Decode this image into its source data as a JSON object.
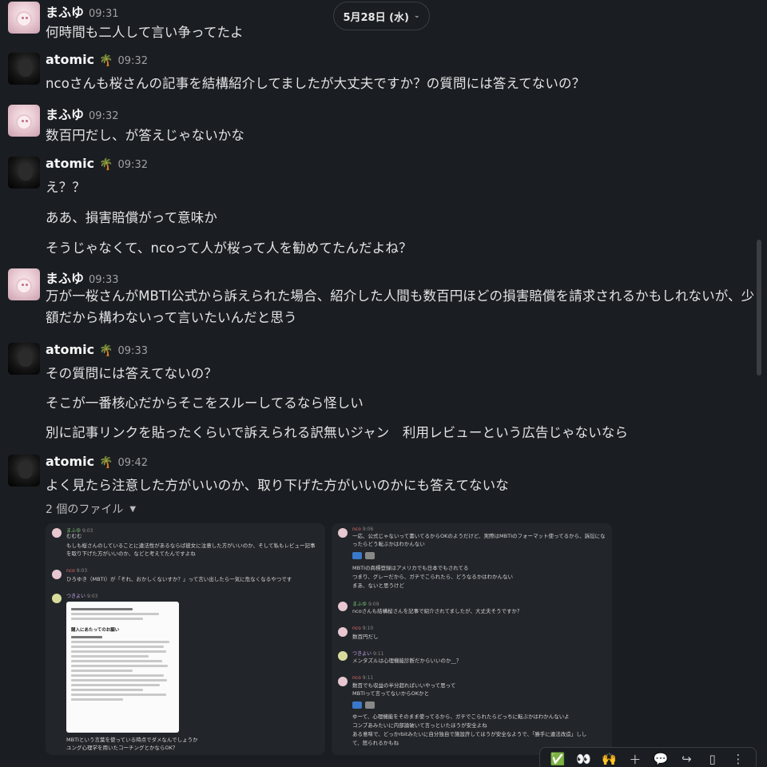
{
  "date_divider": {
    "label": "5月28日 (水)"
  },
  "messages": [
    {
      "author": "まふゆ",
      "time": "09:31",
      "lines": [
        "何時間も二人して言い争ってたよ"
      ]
    },
    {
      "author": "atomic",
      "emoji": "🌴",
      "time": "09:32",
      "lines": [
        "ncoさんも桜さんの記事を結構紹介してましたが大丈夫ですか？の質問には答えてないの？"
      ]
    },
    {
      "author": "まふゆ",
      "time": "09:32",
      "lines": [
        "数百円だし、が答えじゃないかな"
      ]
    },
    {
      "author": "atomic",
      "emoji": "🌴",
      "time": "09:32",
      "lines": [
        "え？？",
        "ああ、損害賠償がって意味か",
        "そうじゃなくて、ncoって人が桜って人を勧めてたんだよね？"
      ]
    },
    {
      "author": "まふゆ",
      "time": "09:33",
      "lines": [
        "万が一桜さんがMBTI公式から訴えられた場合、紹介した人間も数百円ほどの損害賠償を請求されるかもしれないが、少額だから構わないって言いたいんだと思う"
      ]
    },
    {
      "author": "atomic",
      "emoji": "🌴",
      "time": "09:33",
      "lines": [
        "その質問には答えてないの？",
        "そこが一番核心だからそこをスルーしてるなら怪しい",
        "別に記事リンクを貼ったくらいで訴えられる訳無いジャン　利用レビューという広告じゃないなら"
      ]
    },
    {
      "author": "atomic",
      "emoji": "🌴",
      "time": "09:42",
      "lines": [
        "よく見たら注意した方がいいのか、取り下げた方がいいのかにも答えてないな"
      ]
    }
  ],
  "files": {
    "label": "2 個のファイル"
  },
  "attachment1": {
    "names": [
      "まふゆ",
      "nco",
      "つきよい"
    ],
    "times": [
      "9:03",
      "9:03",
      "9:03"
    ],
    "texts": [
      "むむむ",
      "もしも桜さんのしていることに違法性があるならば彼女に注意した方がいいのか、そして私もレビュー記事",
      "を取り下げた方がいいのか、などと考えてたんですよね",
      "ひろゆき（MBTI）が「それ、おかしくないすか？」って言い出したら一気に危なくなるやつです",
      "MBTIという言葉を使っている時点でダメなんでしょうか",
      "ユング心理学を用いたコーチングとかならOK？"
    ],
    "doc_title": "購入にあたってのお願い"
  },
  "attachment2": {
    "names": [
      "nco",
      "まふゆ",
      "nco",
      "つきよい",
      "nco"
    ],
    "times": [
      "9:06",
      "9:09",
      "9:10",
      "9:11",
      "9:11"
    ],
    "texts": [
      "一応、公式じゃないって書いてるからOKのようだけど、実際はMBTIのフォーマット使ってるから、訴訟にな",
      "ったらどう転ぶかはわかんない",
      "MBTIの商標登録はアメリカでも日本でもされてる",
      "つまり、グレーだから、ガチでこられたら、どうなるかはわかんない",
      "まあ、ないと思うけど",
      "ncoさんも結構桜さんを記事で紹介されてましたが、大丈夫そうですか？",
      "数百円だし",
      "メンタズルは心理機能診断だからいいのか__？",
      "数百でも収益の半分超ればいいやって思って",
      "MBTIって言ってないからOKかと",
      "ゆーて、心理機能をそのまま使ってるから、ガチでこられたらどっちに転ぶかはわかんないよ",
      "コンブあみたいに内部論破いて言っといたほうが安全よね",
      "ある意味で、どっかrbitみたいに自分独自で施設許してほうが安全なようで、「勝手に違法改造」しし",
      "て、怒られるかもね"
    ]
  },
  "toolbar": {
    "icons": [
      "✅",
      "👀",
      "🙌",
      "＋",
      "💬",
      "↪",
      "▯",
      "⋮"
    ]
  }
}
